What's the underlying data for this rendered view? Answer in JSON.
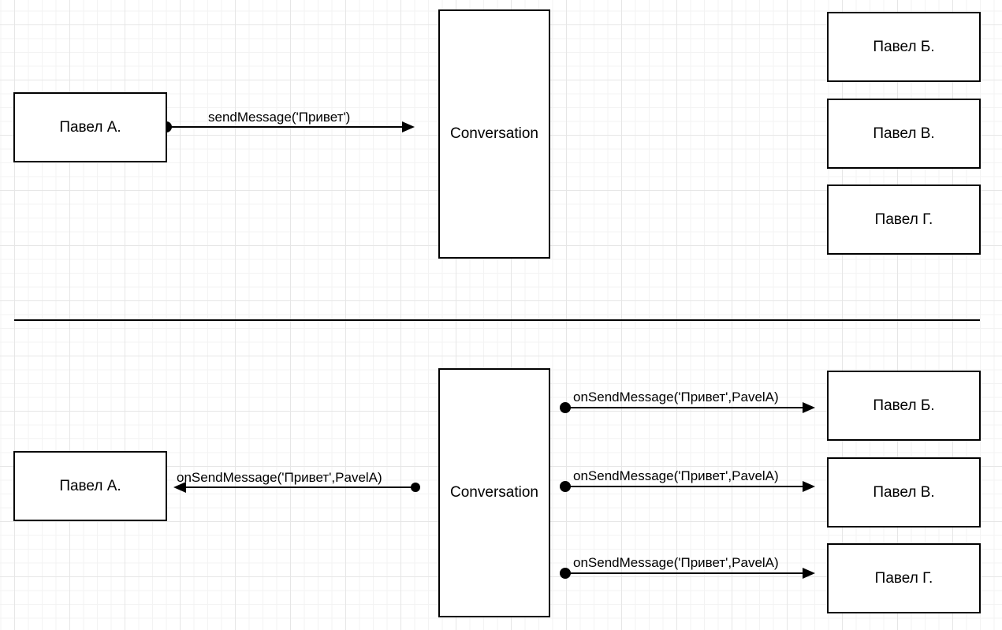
{
  "top": {
    "sender": "Павел А.",
    "message_label": "sendMessage('Привет')",
    "conversation": "Conversation",
    "receivers": [
      "Павел Б.",
      "Павел В.",
      "Павел Г."
    ]
  },
  "bottom": {
    "sender": "Павел А.",
    "sender_callback_label": "onSendMessage('Привет',PavelA)",
    "conversation": "Conversation",
    "receivers": [
      "Павел Б.",
      "Павел В.",
      "Павел Г."
    ],
    "receiver_callback_labels": [
      "onSendMessage('Привет',PavelA)",
      "onSendMessage('Привет',PavelA)",
      "onSendMessage('Привет',PavelA)"
    ]
  }
}
